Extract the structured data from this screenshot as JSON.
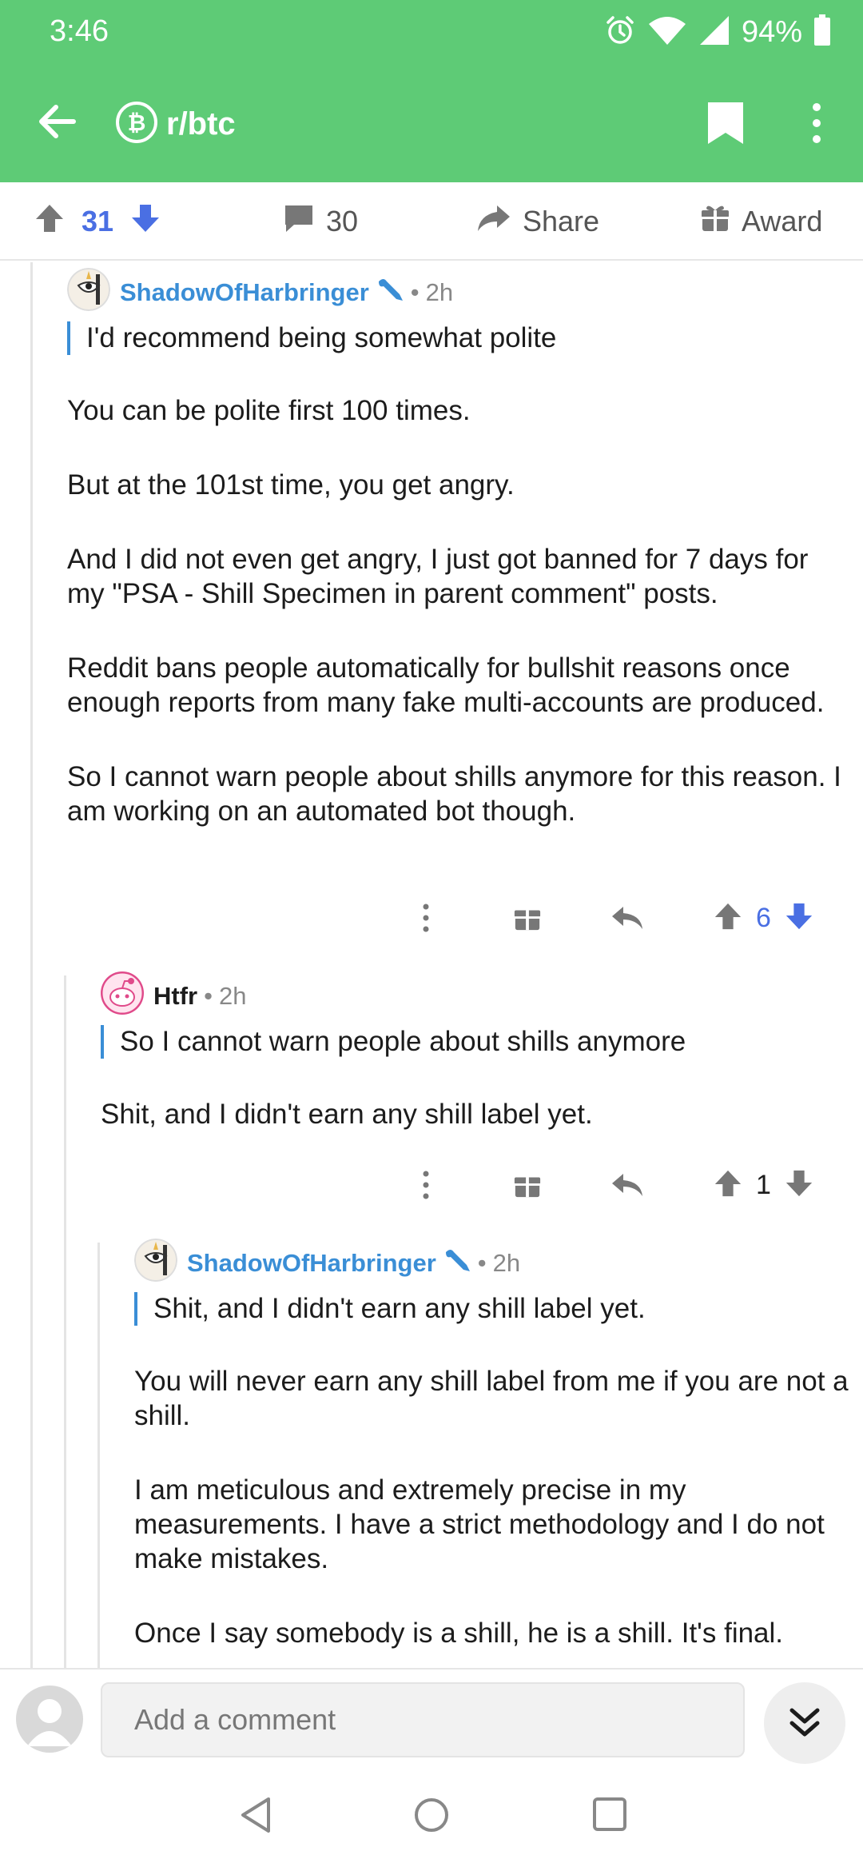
{
  "status_bar": {
    "time": "3:46",
    "battery": "94%",
    "icons": [
      "alarm-icon",
      "wifi-icon",
      "signal-icon",
      "battery-icon"
    ]
  },
  "app_bar": {
    "subreddit": "r/btc",
    "icons": [
      "back-arrow-icon",
      "bitcoin-icon",
      "bookmark-icon",
      "more-vertical-icon"
    ]
  },
  "post_actions": {
    "score": "31",
    "comments": "30",
    "share": "Share",
    "award": "Award"
  },
  "comments": [
    {
      "author": "ShadowOfHarbringer",
      "age": "2h",
      "quote": "I'd recommend being somewhat polite",
      "paragraphs": [
        "You can be polite first 100 times.",
        "But at the 101st time, you get angry.",
        "And I did not even get angry, I just got banned for 7 days for my \"PSA - Shill Specimen in parent comment\" posts.",
        "Reddit bans people automatically for bullshit reasons once enough reports from many fake multi-accounts are produced.",
        "So I cannot warn people about shills anymore for this reason. I am working on an automated bot though."
      ],
      "score": "6"
    },
    {
      "author": "Htfr",
      "age": "2h",
      "quote": "So I cannot warn people about shills anymore",
      "paragraphs": [
        "Shit, and I didn't earn any shill label yet."
      ],
      "score": "1"
    },
    {
      "author": "ShadowOfHarbringer",
      "age": "2h",
      "quote": "Shit, and I didn't earn any shill label yet.",
      "paragraphs": [
        "You will never earn any shill label from me if you are not a shill.",
        "I am meticulous and extremely precise in my measurements. I have a strict methodology and I do not make mistakes.",
        "Once I say somebody is a shill, he is a shill. It's final."
      ]
    }
  ],
  "comment_bar": {
    "placeholder": "Add a comment"
  },
  "colors": {
    "header_green": "#5ecb76",
    "author_blue": "#3a8ed6",
    "upvote_blue": "#4a6fe3"
  }
}
